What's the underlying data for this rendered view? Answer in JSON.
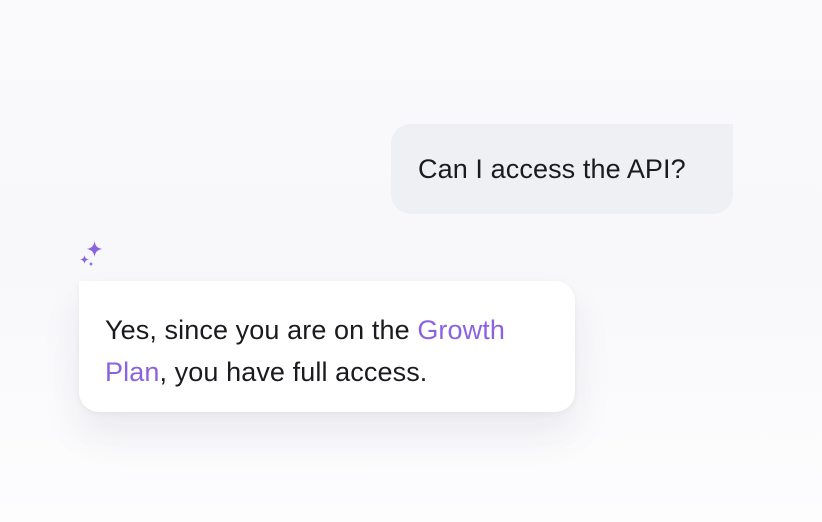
{
  "user_message": {
    "text": "Can I access the API?"
  },
  "assistant": {
    "icon": "sparkle-icon",
    "message": {
      "before": "Yes, since you are on the ",
      "highlight": "Growth Plan",
      "after": ", you have full access."
    }
  },
  "colors": {
    "accent": "#8b62e0",
    "user_bubble": "#eef0f4",
    "assistant_bubble": "#ffffff",
    "text": "#1a1a1f"
  }
}
